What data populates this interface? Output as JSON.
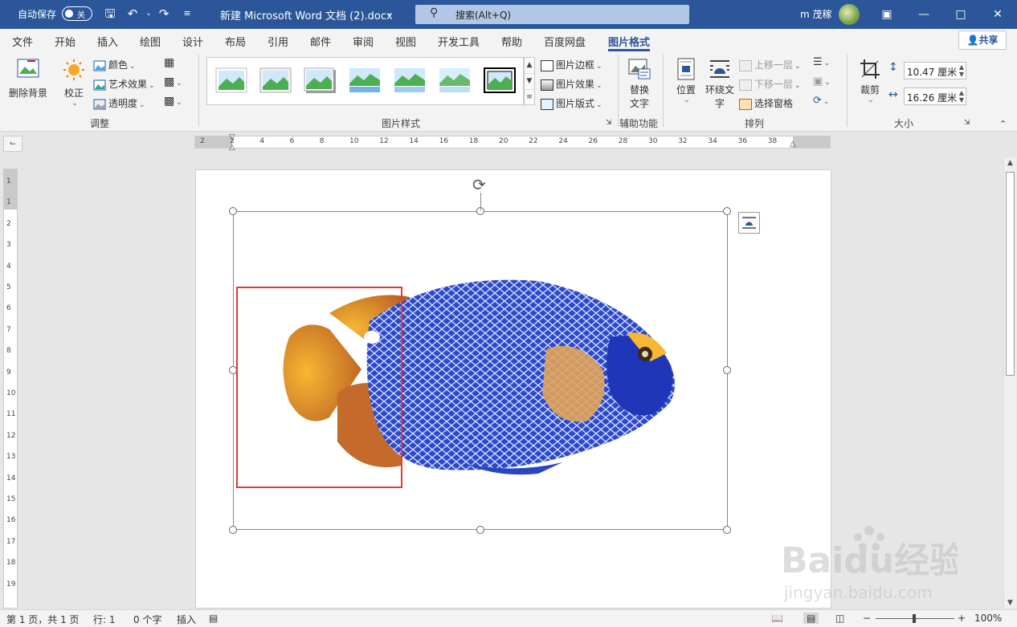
{
  "titlebar": {
    "autosave_label": "自动保存",
    "autosave_state": "关",
    "doc_title": "新建 Microsoft Word 文档 (2).docx",
    "search_placeholder": "搜索(Alt+Q)",
    "user_name": "m 茂稼"
  },
  "tabs": [
    "文件",
    "开始",
    "插入",
    "绘图",
    "设计",
    "布局",
    "引用",
    "邮件",
    "审阅",
    "视图",
    "开发工具",
    "帮助",
    "百度网盘",
    "图片格式"
  ],
  "active_tab": "图片格式",
  "share_label": "共享",
  "ribbon": {
    "adjust": {
      "remove_bg": "删除背景",
      "corrections": "校正",
      "color": "颜色",
      "artistic": "艺术效果",
      "transparency": "透明度",
      "group_label": "调整"
    },
    "styles": {
      "border": "图片边框",
      "effects": "图片效果",
      "layout": "图片版式",
      "group_label": "图片样式"
    },
    "accessibility": {
      "alt_text_line1": "替换",
      "alt_text_line2": "文字",
      "group_label": "辅助功能"
    },
    "arrange": {
      "position": "位置",
      "wrap_line1": "环绕文",
      "wrap_line2": "字",
      "bring_forward": "上移一层",
      "send_backward": "下移一层",
      "selection_pane": "选择窗格",
      "group_label": "排列"
    },
    "size": {
      "crop": "裁剪",
      "height": "10.47 厘米",
      "width": "16.26 厘米",
      "group_label": "大小"
    }
  },
  "ruler": {
    "h_ticks": [
      "2",
      "2",
      "4",
      "6",
      "8",
      "10",
      "12",
      "14",
      "16",
      "18",
      "20",
      "22",
      "24",
      "26",
      "28",
      "30",
      "32",
      "34",
      "36",
      "38"
    ],
    "v_ticks": [
      "1",
      "1",
      "2",
      "3",
      "4",
      "5",
      "6",
      "7",
      "8",
      "9",
      "10",
      "11",
      "12",
      "13",
      "14",
      "15",
      "16",
      "17",
      "18",
      "19"
    ]
  },
  "statusbar": {
    "page": "第 1 页，共 1 页",
    "line": "行: 1",
    "words": "0 个字",
    "mode": "插入",
    "zoom": "100%"
  },
  "watermark": {
    "brand": "Baidu经验",
    "url": "jingyan.baidu.com"
  },
  "colors": {
    "titlebar": "#2b579a",
    "selection_highlight": "#e53935"
  }
}
